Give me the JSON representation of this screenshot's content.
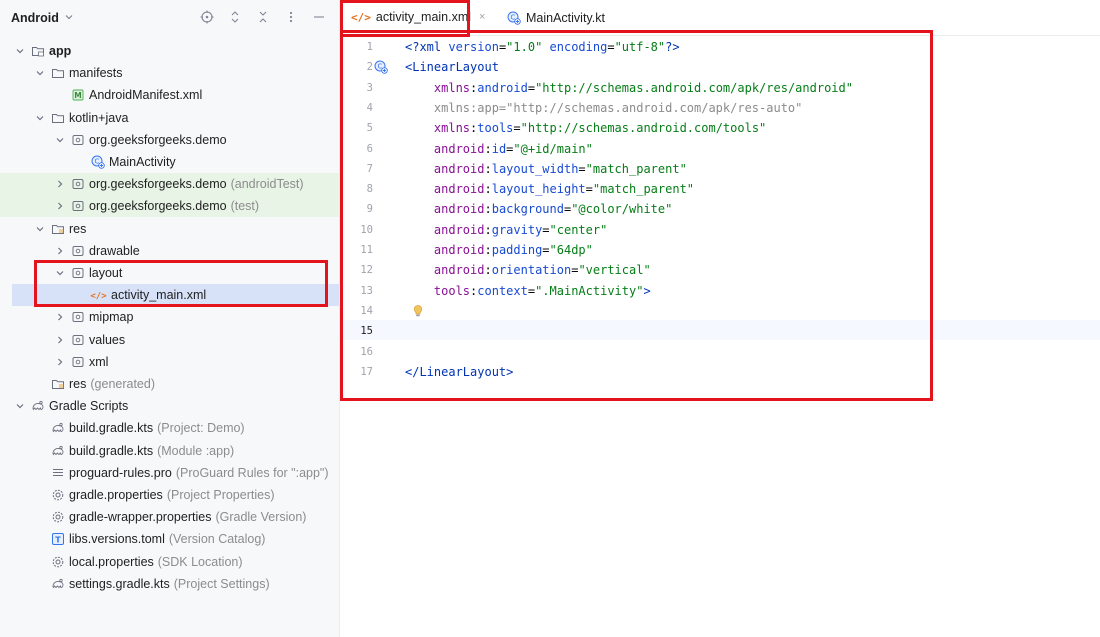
{
  "panel": {
    "title": "Android",
    "tools": [
      "crosshair-icon",
      "expand-icon",
      "collapse-icon",
      "more-icon",
      "minimize-icon"
    ]
  },
  "tree": [
    {
      "label": "app",
      "bold": true,
      "icon": "module-folder-icon",
      "chevron": "down",
      "depth": 0
    },
    {
      "label": "manifests",
      "icon": "folder-icon",
      "chevron": "down",
      "depth": 1
    },
    {
      "label": "AndroidManifest.xml",
      "icon": "manifest-icon",
      "chevron": "",
      "depth": 2
    },
    {
      "label": "kotlin+java",
      "icon": "folder-icon",
      "chevron": "down",
      "depth": 1
    },
    {
      "label": "org.geeksforgeeks.demo",
      "icon": "package-icon",
      "chevron": "down",
      "depth": 2
    },
    {
      "label": "MainActivity",
      "icon": "class-icon",
      "chevron": "",
      "depth": 3
    },
    {
      "label": "org.geeksforgeeks.demo",
      "suffix": "(androidTest)",
      "icon": "package-icon",
      "chevron": "right",
      "depth": 2,
      "green": true
    },
    {
      "label": "org.geeksforgeeks.demo",
      "suffix": "(test)",
      "icon": "package-icon",
      "chevron": "right",
      "depth": 2,
      "green": true
    },
    {
      "label": "res",
      "icon": "res-folder-icon",
      "chevron": "down",
      "depth": 1
    },
    {
      "label": "drawable",
      "icon": "package-icon",
      "chevron": "right",
      "depth": 2
    },
    {
      "label": "layout",
      "icon": "package-icon",
      "chevron": "down",
      "depth": 2
    },
    {
      "label": "activity_main.xml",
      "icon": "xml-file-icon",
      "chevron": "",
      "depth": 3,
      "selected": true
    },
    {
      "label": "mipmap",
      "icon": "package-icon",
      "chevron": "right",
      "depth": 2
    },
    {
      "label": "values",
      "icon": "package-icon",
      "chevron": "right",
      "depth": 2
    },
    {
      "label": "xml",
      "icon": "package-icon",
      "chevron": "right",
      "depth": 2
    },
    {
      "label": "res",
      "suffix": "(generated)",
      "icon": "res-folder-icon",
      "chevron": "",
      "depth": 1
    },
    {
      "label": "Gradle Scripts",
      "icon": "gradle-icon",
      "chevron": "down",
      "depth": 0
    },
    {
      "label": "build.gradle.kts",
      "suffix": "(Project: Demo)",
      "icon": "gradle-icon",
      "chevron": "",
      "depth": 1
    },
    {
      "label": "build.gradle.kts",
      "suffix": "(Module :app)",
      "icon": "gradle-icon",
      "chevron": "",
      "depth": 1
    },
    {
      "label": "proguard-rules.pro",
      "suffix": "(ProGuard Rules for \":app\")",
      "icon": "text-file-icon",
      "chevron": "",
      "depth": 1
    },
    {
      "label": "gradle.properties",
      "suffix": "(Project Properties)",
      "icon": "settings-icon",
      "chevron": "",
      "depth": 1
    },
    {
      "label": "gradle-wrapper.properties",
      "suffix": "(Gradle Version)",
      "icon": "settings-icon",
      "chevron": "",
      "depth": 1
    },
    {
      "label": "libs.versions.toml",
      "suffix": "(Version Catalog)",
      "icon": "toml-icon",
      "chevron": "",
      "depth": 1
    },
    {
      "label": "local.properties",
      "suffix": "(SDK Location)",
      "icon": "settings-icon",
      "chevron": "",
      "depth": 1
    },
    {
      "label": "settings.gradle.kts",
      "suffix": "(Project Settings)",
      "icon": "gradle-icon",
      "chevron": "",
      "depth": 1
    }
  ],
  "tabs": {
    "active": {
      "label": "activity_main.xml",
      "close": "×",
      "icon": "xml-file-icon"
    },
    "inactive": {
      "label": "MainActivity.kt",
      "icon": "class-icon"
    }
  },
  "editor": {
    "current_line": 15,
    "lines": [
      {
        "n": "1",
        "segments": [
          [
            "c-prolog",
            "<?xml "
          ],
          [
            "c-attr",
            "version"
          ],
          [
            "c-plain",
            "="
          ],
          [
            "c-val",
            "\"1.0\""
          ],
          [
            "c-plain",
            " "
          ],
          [
            "c-attr",
            "encoding"
          ],
          [
            "c-plain",
            "="
          ],
          [
            "c-val",
            "\"utf-8\""
          ],
          [
            "c-prolog",
            "?>"
          ]
        ]
      },
      {
        "n": "2",
        "segments": [
          [
            "c-tag",
            "<LinearLayout"
          ]
        ],
        "gutter_icon": "class-icon"
      },
      {
        "n": "3",
        "segments": [
          [
            "c-plain",
            "    "
          ],
          [
            "c-ns",
            "xmlns"
          ],
          [
            "c-plain",
            ":"
          ],
          [
            "c-attr",
            "android"
          ],
          [
            "c-plain",
            "="
          ],
          [
            "c-val",
            "\"http://schemas.android.com/apk/res/android\""
          ]
        ]
      },
      {
        "n": "4",
        "segments": [
          [
            "c-plain",
            "    "
          ],
          [
            "c-gray",
            "xmlns:app=\"http://schemas.android.com/apk/res-auto\""
          ]
        ]
      },
      {
        "n": "5",
        "segments": [
          [
            "c-plain",
            "    "
          ],
          [
            "c-ns",
            "xmlns"
          ],
          [
            "c-plain",
            ":"
          ],
          [
            "c-attr",
            "tools"
          ],
          [
            "c-plain",
            "="
          ],
          [
            "c-val",
            "\"http://schemas.android.com/tools\""
          ]
        ]
      },
      {
        "n": "6",
        "segments": [
          [
            "c-plain",
            "    "
          ],
          [
            "c-ns",
            "android"
          ],
          [
            "c-plain",
            ":"
          ],
          [
            "c-attr",
            "id"
          ],
          [
            "c-plain",
            "="
          ],
          [
            "c-val",
            "\"@+id/main\""
          ]
        ]
      },
      {
        "n": "7",
        "segments": [
          [
            "c-plain",
            "    "
          ],
          [
            "c-ns",
            "android"
          ],
          [
            "c-plain",
            ":"
          ],
          [
            "c-attr",
            "layout_width"
          ],
          [
            "c-plain",
            "="
          ],
          [
            "c-val",
            "\"match_parent\""
          ]
        ]
      },
      {
        "n": "8",
        "segments": [
          [
            "c-plain",
            "    "
          ],
          [
            "c-ns",
            "android"
          ],
          [
            "c-plain",
            ":"
          ],
          [
            "c-attr",
            "layout_height"
          ],
          [
            "c-plain",
            "="
          ],
          [
            "c-val",
            "\"match_parent\""
          ]
        ]
      },
      {
        "n": "9",
        "segments": [
          [
            "c-plain",
            "    "
          ],
          [
            "c-ns",
            "android"
          ],
          [
            "c-plain",
            ":"
          ],
          [
            "c-attr",
            "background"
          ],
          [
            "c-plain",
            "="
          ],
          [
            "c-val",
            "\"@color/white\""
          ]
        ]
      },
      {
        "n": "10",
        "segments": [
          [
            "c-plain",
            "    "
          ],
          [
            "c-ns",
            "android"
          ],
          [
            "c-plain",
            ":"
          ],
          [
            "c-attr",
            "gravity"
          ],
          [
            "c-plain",
            "="
          ],
          [
            "c-val",
            "\"center\""
          ]
        ]
      },
      {
        "n": "11",
        "segments": [
          [
            "c-plain",
            "    "
          ],
          [
            "c-ns",
            "android"
          ],
          [
            "c-plain",
            ":"
          ],
          [
            "c-attr",
            "padding"
          ],
          [
            "c-plain",
            "="
          ],
          [
            "c-val",
            "\"64dp\""
          ]
        ]
      },
      {
        "n": "12",
        "segments": [
          [
            "c-plain",
            "    "
          ],
          [
            "c-ns",
            "android"
          ],
          [
            "c-plain",
            ":"
          ],
          [
            "c-attr",
            "orientation"
          ],
          [
            "c-plain",
            "="
          ],
          [
            "c-val",
            "\"vertical\""
          ]
        ]
      },
      {
        "n": "13",
        "segments": [
          [
            "c-plain",
            "    "
          ],
          [
            "c-ns",
            "tools"
          ],
          [
            "c-plain",
            ":"
          ],
          [
            "c-attr",
            "context"
          ],
          [
            "c-plain",
            "="
          ],
          [
            "c-val",
            "\".MainActivity\""
          ],
          [
            "c-tag",
            ">"
          ]
        ]
      },
      {
        "n": "14",
        "segments": [],
        "gutter_icon": "lightbulb-icon"
      },
      {
        "n": "15",
        "segments": []
      },
      {
        "n": "16",
        "segments": []
      },
      {
        "n": "17",
        "segments": [
          [
            "c-tag",
            "</LinearLayout>"
          ]
        ]
      }
    ]
  },
  "colors": {
    "highlight_box": "#e3141b",
    "selection": "#d7e2f8",
    "test_source_bg": "#e8f5e6",
    "accent": "#3574f0"
  }
}
